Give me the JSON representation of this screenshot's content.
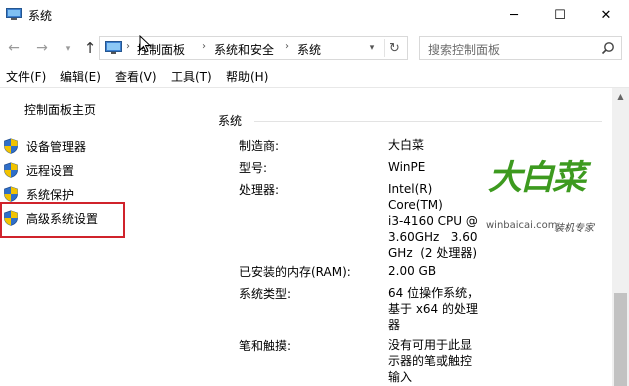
{
  "window": {
    "title": "系统",
    "controls": {
      "minimize": "─",
      "maximize": "☐",
      "close": "✕"
    }
  },
  "address_bar": {
    "breadcrumbs": [
      "控制面板",
      "系统和安全",
      "系统"
    ],
    "separator": "›"
  },
  "search": {
    "placeholder": "搜索控制面板"
  },
  "menu": [
    "文件(F)",
    "编辑(E)",
    "查看(V)",
    "工具(T)",
    "帮助(H)"
  ],
  "sidebar": {
    "home": "控制面板主页",
    "links": [
      "设备管理器",
      "远程设置",
      "系统保护",
      "高级系统设置"
    ],
    "highlighted_link": "高级系统设置",
    "highlight_color": "#d0232b"
  },
  "system": {
    "section_title": "系统",
    "rows": [
      {
        "label": "制造商:",
        "value": "大白菜"
      },
      {
        "label": "型号:",
        "value": "WinPE"
      },
      {
        "label": "处理器:",
        "value_lines": [
          "Intel(R)",
          "Core(TM)",
          "i3-4160 CPU @",
          "3.60GHz   3.60",
          "GHz  (2 处理器)"
        ]
      },
      {
        "label": "已安装的内存(RAM):",
        "value": "2.00 GB"
      },
      {
        "label": "系统类型:",
        "value_lines": [
          "64 位操作系统，",
          "基于 x64 的处理",
          "器"
        ]
      },
      {
        "label": "笔和触摸:",
        "value_lines": [
          "没有可用于此显",
          "示器的笔或触控",
          "输入"
        ]
      }
    ]
  },
  "logo": {
    "main_text": "大白菜",
    "url_text": "winbaicai.com",
    "slogan": "装机专家",
    "color": "#3d9a1f"
  }
}
